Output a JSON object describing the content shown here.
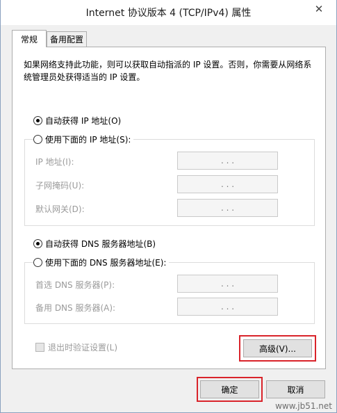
{
  "window": {
    "title": "Internet 协议版本 4 (TCP/IPv4) 属性",
    "close_glyph": "✕"
  },
  "tabs": [
    {
      "label": "常规",
      "active": true
    },
    {
      "label": "备用配置",
      "active": false
    }
  ],
  "description": "如果网络支持此功能，则可以获取自动指派的 IP 设置。否则，你需要从网络系统管理员处获得适当的 IP 设置。",
  "ip_section": {
    "auto_label": "自动获得 IP 地址(O)",
    "manual_label": "使用下面的 IP 地址(S):",
    "auto_selected": true,
    "fields": [
      {
        "label": "IP 地址(I):",
        "value": ".       .       ."
      },
      {
        "label": "子网掩码(U):",
        "value": ".       .       ."
      },
      {
        "label": "默认网关(D):",
        "value": ".       .       ."
      }
    ]
  },
  "dns_section": {
    "auto_label": "自动获得 DNS 服务器地址(B)",
    "manual_label": "使用下面的 DNS 服务器地址(E):",
    "auto_selected": true,
    "fields": [
      {
        "label": "首选 DNS 服务器(P):",
        "value": ".       .       ."
      },
      {
        "label": "备用 DNS 服务器(A):",
        "value": ".       .       ."
      }
    ]
  },
  "validate_checkbox": {
    "label": "退出时验证设置(L)",
    "checked": false
  },
  "buttons": {
    "advanced": "高级(V)...",
    "ok": "确定",
    "cancel": "取消"
  },
  "watermark": "www.jb51.net",
  "colors": {
    "highlight": "#d9232a",
    "background": "#f0f0f0"
  }
}
